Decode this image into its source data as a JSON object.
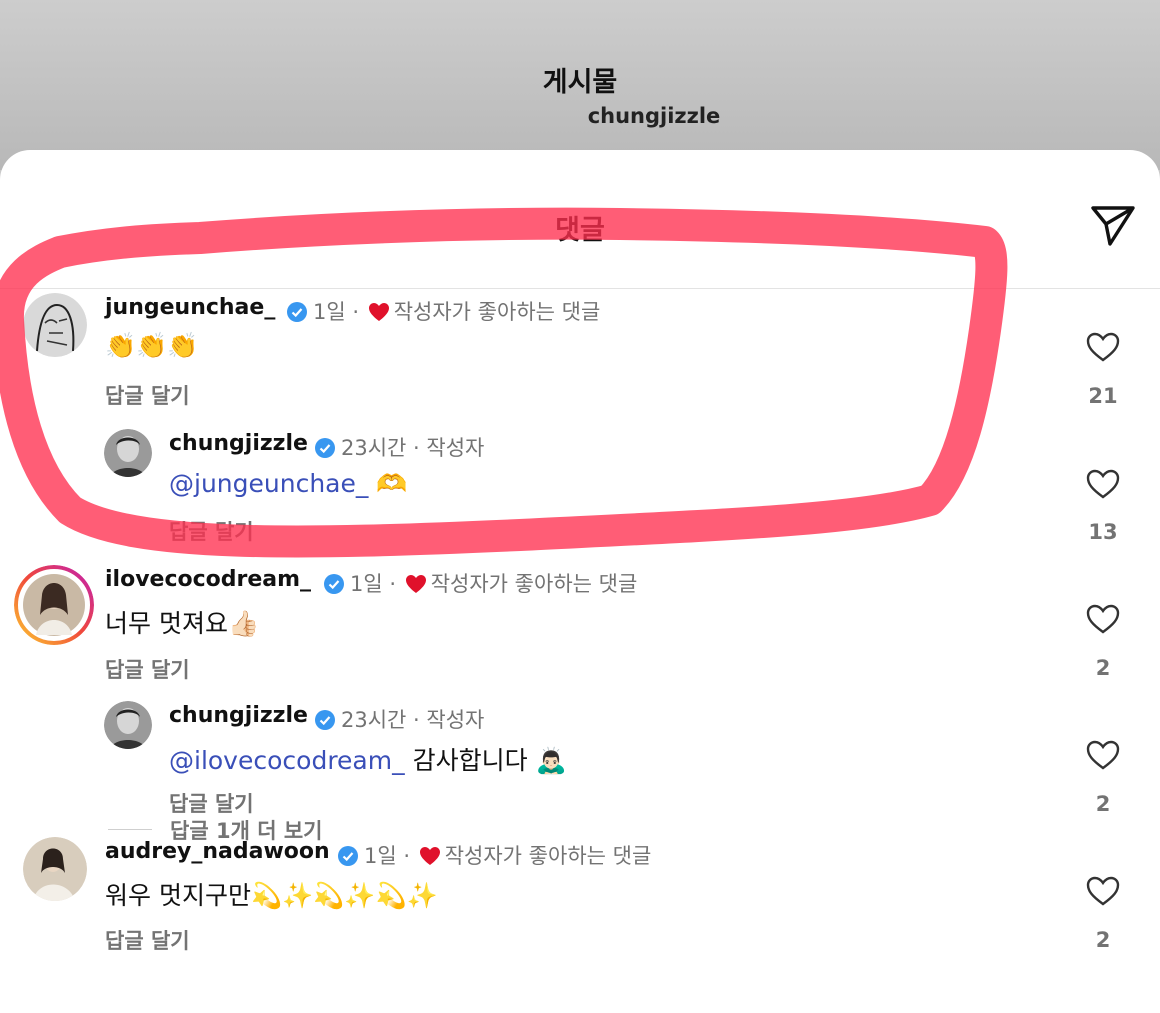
{
  "header": {
    "title": "게시물",
    "subtitle": "chungjizzle"
  },
  "sheet": {
    "title": "댓글",
    "share_icon": "paper-plane-icon"
  },
  "comments": [
    {
      "username": "jungeunchae_",
      "verified": true,
      "time": "1일",
      "liked_by_author": "작성자가 좋아하는 댓글",
      "text": "👏👏👏",
      "reply_label": "답글 달기",
      "likes": "21"
    },
    {
      "username": "chungjizzle",
      "verified": true,
      "time": "23시간",
      "author_tag": "작성자",
      "mention": "@jungeunchae_",
      "text": "🫶",
      "reply_label": "답글 달기",
      "likes": "13"
    },
    {
      "username": "ilovecocodream_",
      "verified": true,
      "time": "1일",
      "liked_by_author": "작성자가 좋아하는 댓글",
      "text": "너무 멋져요👍🏻",
      "reply_label": "답글 달기",
      "likes": "2"
    },
    {
      "username": "chungjizzle",
      "verified": true,
      "time": "23시간",
      "author_tag": "작성자",
      "mention": "@ilovecocodream_",
      "text": "감사합니다 🙇🏻‍♂️",
      "reply_label": "답글 달기",
      "likes": "2"
    },
    {
      "username": "audrey_nadawoon",
      "verified": true,
      "time": "1일",
      "liked_by_author": "작성자가 좋아하는 댓글",
      "text": "워우 멋지구만💫✨💫✨💫✨",
      "reply_label": "답글 달기",
      "likes": "2"
    }
  ],
  "more_replies": "답글 1개 더 보기",
  "colors": {
    "highlight": "#ff2f4f",
    "mention": "#3a4fb8",
    "verified": "#3897f0",
    "heart": "#e0112b"
  }
}
